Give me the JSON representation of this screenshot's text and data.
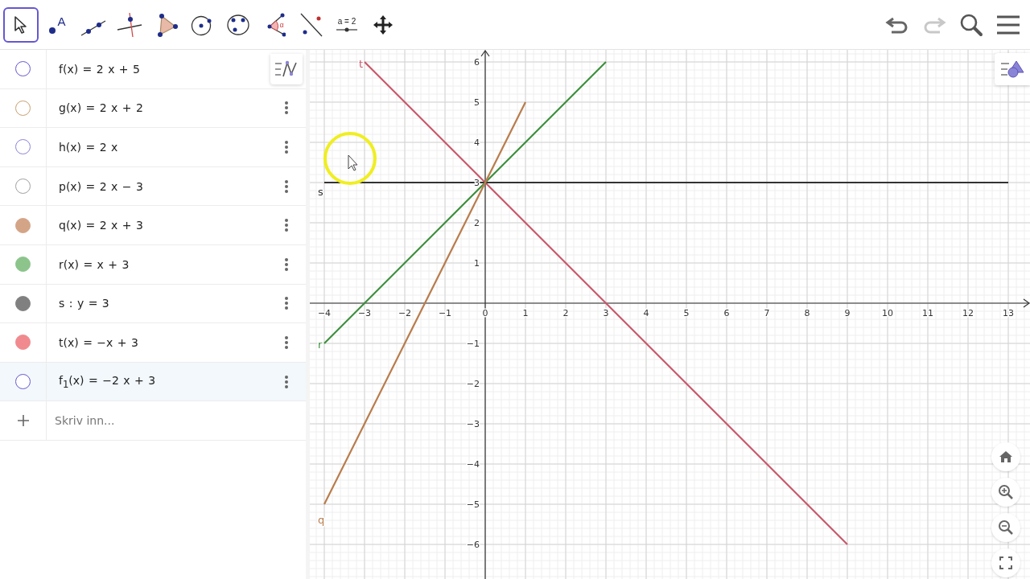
{
  "toolbar": {
    "tools": [
      {
        "kind": "move",
        "selected": true
      },
      {
        "kind": "point",
        "label": "A",
        "selected": false
      },
      {
        "kind": "line",
        "selected": false
      },
      {
        "kind": "perpendicular",
        "selected": false
      },
      {
        "kind": "polygon",
        "selected": false
      },
      {
        "kind": "circle",
        "selected": false
      },
      {
        "kind": "conic",
        "selected": false
      },
      {
        "kind": "angle",
        "label": "α",
        "selected": false
      },
      {
        "kind": "reflect",
        "selected": false
      },
      {
        "kind": "slider",
        "label": "a = 2",
        "selected": false
      },
      {
        "kind": "pan",
        "selected": false
      }
    ],
    "undo": {
      "disabled": false
    },
    "redo": {
      "disabled": true
    }
  },
  "algebra": {
    "rows": [
      {
        "expr": "f(x) = 2 x + 5",
        "visible": false,
        "color": "#6557d2",
        "selected": false
      },
      {
        "expr": "g(x) = 2 x + 2",
        "visible": false,
        "color": "#c8a070",
        "selected": false
      },
      {
        "expr": "h(x) = 2 x",
        "visible": false,
        "color": "#8a84d6",
        "selected": false
      },
      {
        "expr": "p(x) = 2 x − 3",
        "visible": false,
        "color": "#a0a0a0",
        "selected": false
      },
      {
        "expr": "q(x) = 2 x + 3",
        "visible": true,
        "color": "#d4a487",
        "selected": false
      },
      {
        "expr": "r(x) = x + 3",
        "visible": true,
        "color": "#8cc48c",
        "selected": false
      },
      {
        "expr": "s : y = 3",
        "visible": true,
        "color": "#808080",
        "selected": false
      },
      {
        "expr": "t(x) = −x + 3",
        "visible": true,
        "color": "#f08a8e",
        "selected": false
      },
      {
        "expr": "f$_{1}$(x) = −2 x + 3",
        "visible": false,
        "color": "#6557d2",
        "selected": true
      }
    ],
    "input": {
      "placeholder": "Skriv inn..."
    }
  },
  "graphics": {
    "chart_data": {
      "type": "line",
      "grid": true,
      "x": [
        -4,
        -3,
        -2,
        -1,
        0,
        1,
        2,
        3,
        4,
        5,
        6,
        7,
        8,
        9,
        10,
        11,
        12,
        13
      ],
      "xlim": [
        -4.36,
        13.54
      ],
      "ylim": [
        -6.86,
        6.3
      ],
      "xticks": [
        -4,
        -3,
        -2,
        -1,
        0,
        1,
        2,
        3,
        4,
        5,
        6,
        7,
        8,
        9,
        10,
        11,
        12,
        13
      ],
      "yticks": [
        -6,
        -5,
        -4,
        -3,
        -2,
        -1,
        1,
        2,
        3,
        4,
        5,
        6
      ],
      "series": [
        {
          "name": "t",
          "color": "#c9586a",
          "values": [
            null,
            6,
            5,
            4,
            3,
            2,
            1,
            0,
            -1,
            -2,
            -3,
            -4,
            -5,
            -6,
            null,
            null,
            null,
            null
          ]
        },
        {
          "name": "s",
          "color": "#333333",
          "values": [
            3,
            3,
            3,
            3,
            3,
            3,
            3,
            3,
            3,
            3,
            3,
            3,
            3,
            3,
            3,
            3,
            3,
            3
          ]
        },
        {
          "name": "r",
          "color": "#3d8f3d",
          "values": [
            -1,
            0,
            1,
            2,
            3,
            4,
            5,
            6,
            null,
            null,
            null,
            null,
            null,
            null,
            null,
            null,
            null,
            null
          ]
        },
        {
          "name": "q",
          "color": "#b97c4c",
          "values": [
            -5,
            -3,
            -1,
            1,
            3,
            5,
            null,
            null,
            null,
            null,
            null,
            null,
            null,
            null,
            null,
            null,
            null,
            null
          ]
        }
      ]
    }
  }
}
